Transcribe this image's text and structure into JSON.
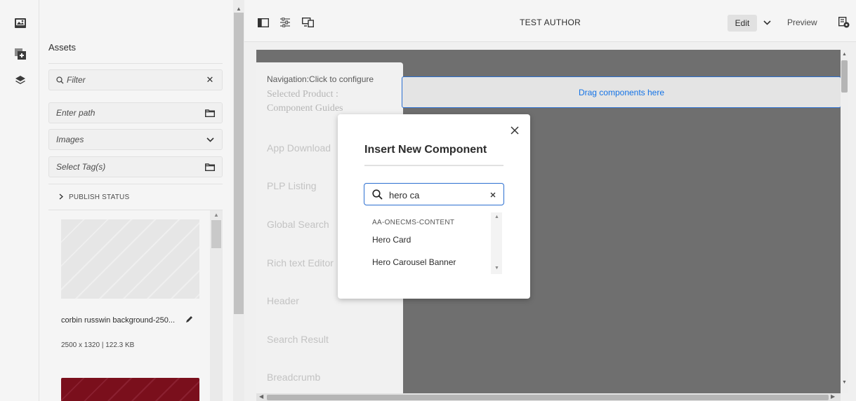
{
  "toolbar": {
    "page_title": "TEST AUTHOR",
    "edit_label": "Edit",
    "preview_label": "Preview"
  },
  "rail": {
    "icons": [
      "assets-icon",
      "components-icon",
      "content-tree-icon"
    ]
  },
  "assets": {
    "title": "Assets",
    "filter_placeholder": "Filter",
    "path_placeholder": "Enter path",
    "type_value": "Images",
    "tags_placeholder": "Select Tag(s)",
    "publish_status_label": "PUBLISH STATUS",
    "asset_name": "corbin russwin background-250...",
    "asset_meta": "2500 x 1320 | 122.3 KB"
  },
  "canvas": {
    "nav_hint": "Navigation:Click to configure",
    "selected_product": "Selected Product :",
    "component_guides": "Component Guides",
    "nav_items": [
      "App Download",
      "PLP Listing",
      "Global Search",
      "Rich text Editor",
      "Header",
      "Search Result",
      "Breadcrumb"
    ],
    "dropzone_label": "Drag components here"
  },
  "dialog": {
    "title": "Insert New Component",
    "search_value": "hero ca",
    "group_label": "AA-ONECMS-CONTENT",
    "results": [
      "Hero Card",
      "Hero Carousel Banner"
    ]
  },
  "colors": {
    "accent": "#1473e6",
    "focus_border": "#2c6fd1",
    "page_bg": "#6f6f6f"
  }
}
